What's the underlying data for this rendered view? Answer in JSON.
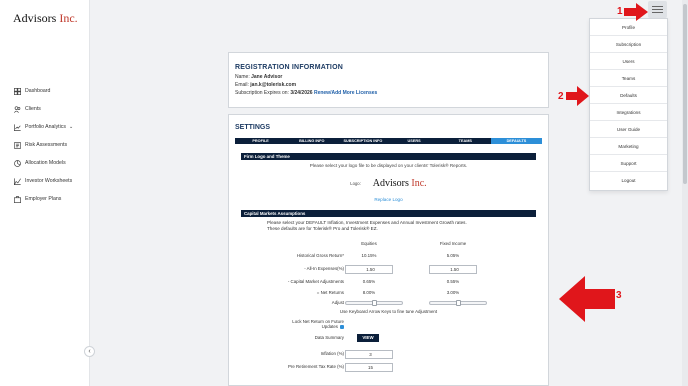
{
  "brand": {
    "name": "Advisors",
    "suffix": "Inc."
  },
  "sidebar": {
    "items": [
      {
        "label": "Dashboard",
        "icon": "dashboard-icon"
      },
      {
        "label": "Clients",
        "icon": "clients-icon"
      },
      {
        "label": "Portfolio Analytics",
        "icon": "analytics-icon"
      },
      {
        "label": "Risk Assessments",
        "icon": "risk-icon"
      },
      {
        "label": "Allocation Models",
        "icon": "pie-icon"
      },
      {
        "label": "Investor Worksheets",
        "icon": "worksheet-icon"
      },
      {
        "label": "Employer Plans",
        "icon": "plans-icon"
      }
    ],
    "collapse_glyph": "‹"
  },
  "registration": {
    "title": "REGISTRATION INFORMATION",
    "name_label": "Name:",
    "name_value": "Jane Advisor",
    "email_label": "Email:",
    "email_value": "jan.k@tolerisk.com",
    "sub_label": "Subscription Expires on:",
    "sub_value": "3/24/2026",
    "sub_link": "Renew/Add More Licenses"
  },
  "settings": {
    "title": "SETTINGS",
    "tabs": [
      "PROFILE",
      "BILLING INFO",
      "SUBSCRIPTION INFO",
      "USERS",
      "TEAMS",
      "DEFAULTS"
    ],
    "active_tab": "DEFAULTS",
    "firm_logo": {
      "header": "Firm Logo and Theme",
      "note": "Please select your logo file to be displayed on your clients' Tolerisk® Reports.",
      "logo_label": "Logo:",
      "replace": "Replace Logo"
    },
    "cma": {
      "header": "Capital Markets Assumptions",
      "intro_1": "Please select your DEFAULT Inflation, Investment Expenses and Annual Investment Growth rates.",
      "intro_2": "These defaults are for Tolerisk® Pro and Tolerisk® EZ.",
      "col_equities": "Equities",
      "col_fixed": "Fixed Income",
      "rows": {
        "hist_label": "Historical Gross Return*",
        "hist_eq": "10.15%",
        "hist_fi": "5.05%",
        "expense_label": "- All-In Expenses(%)",
        "expense_eq": "1.50",
        "expense_fi": "1.50",
        "adj_label": "- Capital Market Adjustments",
        "adj_eq": "0.65%",
        "adj_fi": "0.55%",
        "net_label": "= Net Returns",
        "net_eq": "8.00%",
        "net_fi": "3.00%",
        "adjust_label": "Adjust",
        "hint": "Use Keyboard Arrow Keys to fine tune Adjustment",
        "lock_label_1": "Lock Net Return on Future",
        "lock_label_2": "Updates",
        "summary_label": "Data Summary",
        "view_btn": "VIEW",
        "inflation_label": "Inflation (%)",
        "inflation_value": "3",
        "tax_label": "Pre Retirement Tax Rate (%)",
        "tax_value": "15"
      }
    }
  },
  "menu": {
    "items": [
      "Profile",
      "Subscription",
      "Users",
      "Teams",
      "Defaults",
      "Integrations",
      "User Guide",
      "Marketing",
      "Support",
      "Logout"
    ]
  },
  "annotations": {
    "n1": "1",
    "n2": "2",
    "n3": "3",
    "color": "#e0161b"
  }
}
